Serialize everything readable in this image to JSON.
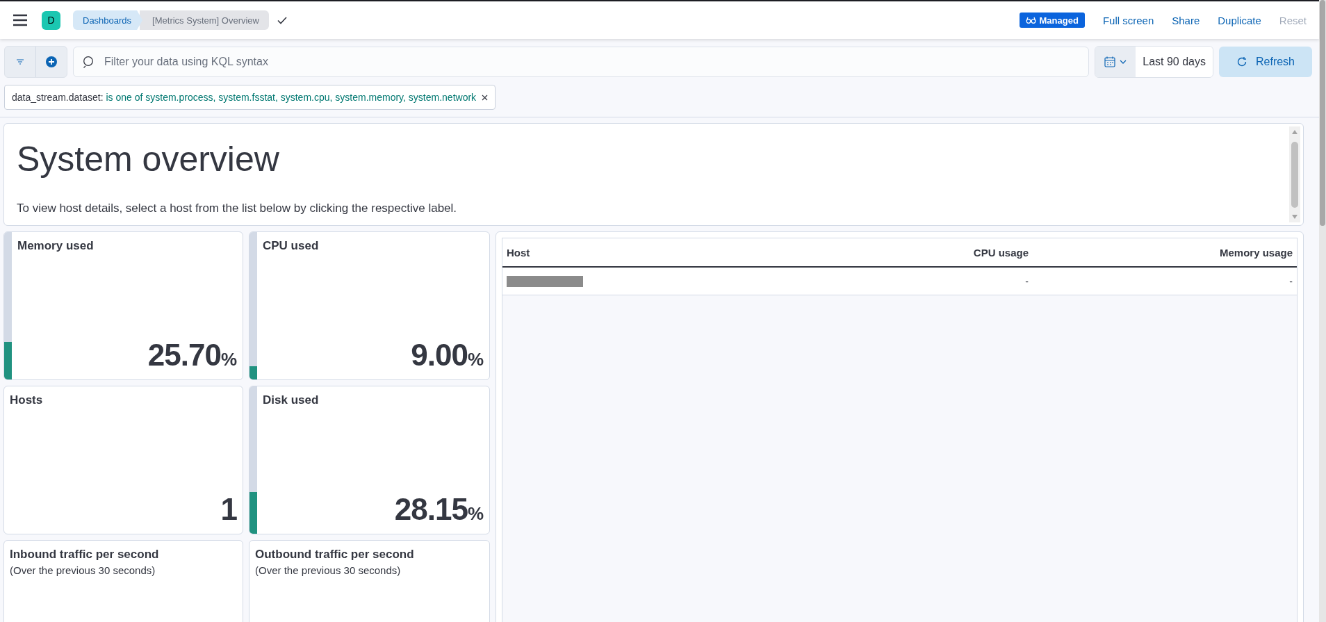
{
  "header": {
    "app_badge": "D",
    "breadcrumbs": [
      {
        "label": "Dashboards",
        "selected": false
      },
      {
        "label": "[Metrics System] Overview",
        "selected": true
      }
    ],
    "managed_badge": "Managed",
    "actions": [
      {
        "label": "Full screen",
        "disabled": false
      },
      {
        "label": "Share",
        "disabled": false
      },
      {
        "label": "Duplicate",
        "disabled": false
      },
      {
        "label": "Reset",
        "disabled": true
      }
    ]
  },
  "query_bar": {
    "placeholder": "Filter your data using KQL syntax",
    "time_range": "Last 90 days",
    "refresh": "Refresh"
  },
  "filters": [
    {
      "field": "data_stream.dataset:",
      "value": "is one of system.process, system.fsstat, system.cpu, system.memory, system.network"
    }
  ],
  "intro": {
    "title": "System overview",
    "text": "To view host details, select a host from the list below by clicking the respective label."
  },
  "metrics": [
    {
      "kind": "meter",
      "title": "Memory used",
      "value": "25.70",
      "unit": "%",
      "level": 0.257
    },
    {
      "kind": "meter",
      "title": "CPU used",
      "value": "9.00",
      "unit": "%",
      "level": 0.09
    },
    {
      "kind": "plain",
      "title": "Hosts",
      "value": "1"
    },
    {
      "kind": "meter",
      "title": "Disk used",
      "value": "28.15",
      "unit": "%",
      "level": 0.2815
    },
    {
      "kind": "plain",
      "title": "Inbound traffic per second",
      "subtitle": "(Over the previous 30 seconds)"
    },
    {
      "kind": "plain",
      "title": "Outbound traffic per second",
      "subtitle": "(Over the previous 30 seconds)"
    }
  ],
  "hosts_table": {
    "columns": [
      "Host",
      "CPU usage",
      "Memory usage"
    ],
    "rows": [
      {
        "host_redacted": true,
        "cpu": "-",
        "memory": "-"
      }
    ]
  }
}
